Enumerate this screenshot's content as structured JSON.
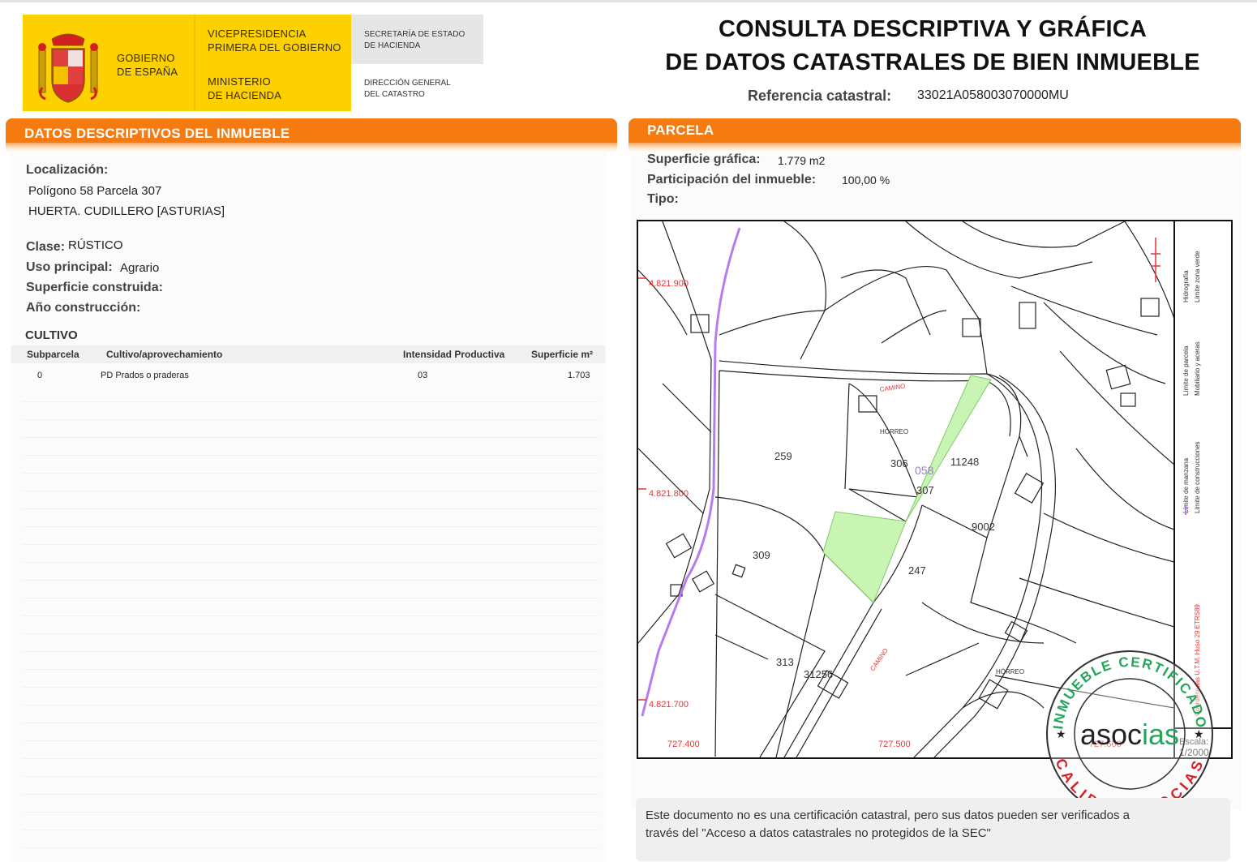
{
  "header": {
    "gobierno": [
      "GOBIERNO",
      "DE ESPAÑA"
    ],
    "vicepresidencia": [
      "VICEPRESIDENCIA",
      "PRIMERA DEL GOBIERNO"
    ],
    "ministerio": [
      "MINISTERIO",
      "DE HACIENDA"
    ],
    "secretaria": [
      "SECRETARÍA DE ESTADO",
      "DE HACIENDA"
    ],
    "direccion": [
      "DIRECCIÓN GENERAL",
      "DEL CATASTRO"
    ]
  },
  "title": {
    "line1": "CONSULTA DESCRIPTIVA Y GRÁFICA",
    "line2": "DE DATOS CATASTRALES DE BIEN INMUEBLE",
    "ref_label": "Referencia catastral:",
    "ref_value": "33021A058003070000MU"
  },
  "descriptive": {
    "heading": "DATOS DESCRIPTIVOS DEL INMUEBLE",
    "localizacion_label": "Localización:",
    "localizacion_l1": "Polígono 58 Parcela 307",
    "localizacion_l2": "HUERTA. CUDILLERO [ASTURIAS]",
    "clase_label": "Clase:",
    "clase_value": "RÚSTICO",
    "uso_label": "Uso principal:",
    "uso_value": "Agrario",
    "superficie_construida_label": "Superficie construida:",
    "ano_label": "Año construcción:",
    "cultivo_heading": "CULTIVO",
    "table_headers": [
      "Subparcela",
      "Cultivo/aprovechamiento",
      "Intensidad Productiva",
      "Superficie m²"
    ],
    "rows": [
      {
        "subparcela": "0",
        "cultivo": "PD Prados o praderas",
        "intensidad": "03",
        "superficie": "1.703"
      }
    ]
  },
  "parcela": {
    "heading": "PARCELA",
    "superficie_label": "Superficie gráfica:",
    "superficie_value": "1.779 m2",
    "participacion_label": "Participación del inmueble:",
    "participacion_value": "100,00 %",
    "tipo_label": "Tipo:"
  },
  "map": {
    "coord_labels": {
      "y1": "4.821.900",
      "y2": "4.821.800",
      "y3": "4.821.700",
      "x1": "727.400",
      "x2": "727.500",
      "x3": "727.600"
    },
    "parcel_labels": [
      "259",
      "306",
      "058",
      "307",
      "11248",
      "9002",
      "309",
      "247",
      "313",
      "31256"
    ],
    "feature_labels": [
      "CAMINO",
      "HÓRREO",
      "CAMINO",
      "HÓRREO"
    ],
    "legend": [
      "Límite de manzana",
      "Límite de parcela",
      "Límite de construcciones",
      "Mobiliario y aceras",
      "Límite zona verde",
      "Hidrografía"
    ],
    "coord_system": "Coordenadas U.T.M. Huso 29 ETRS89",
    "scale_label": "Escala:",
    "scale_value": "1/2000",
    "colors": {
      "parcel_fill": "#c9f5b4",
      "hydro": "#b57cf0",
      "coords": "#e33",
      "purple_label": "#9b7fd6"
    }
  },
  "stamp": {
    "top_text": "INMUEBLE CERTIFICADO",
    "bottom_text": "CALIDAD ASOCIAS",
    "brand_a": "asoc",
    "brand_b": "ias"
  },
  "note": {
    "line1": "Este documento no es una certificación catastral, pero sus datos pueden ser verificados a",
    "line2": "través del \"Acceso a datos catastrales no protegidos de la SEC\""
  },
  "colors": {
    "accent_orange": "#f57a10",
    "logo_yellow": "#fdd000",
    "stamp_green": "#23a55a",
    "stamp_red": "#d8222a"
  }
}
